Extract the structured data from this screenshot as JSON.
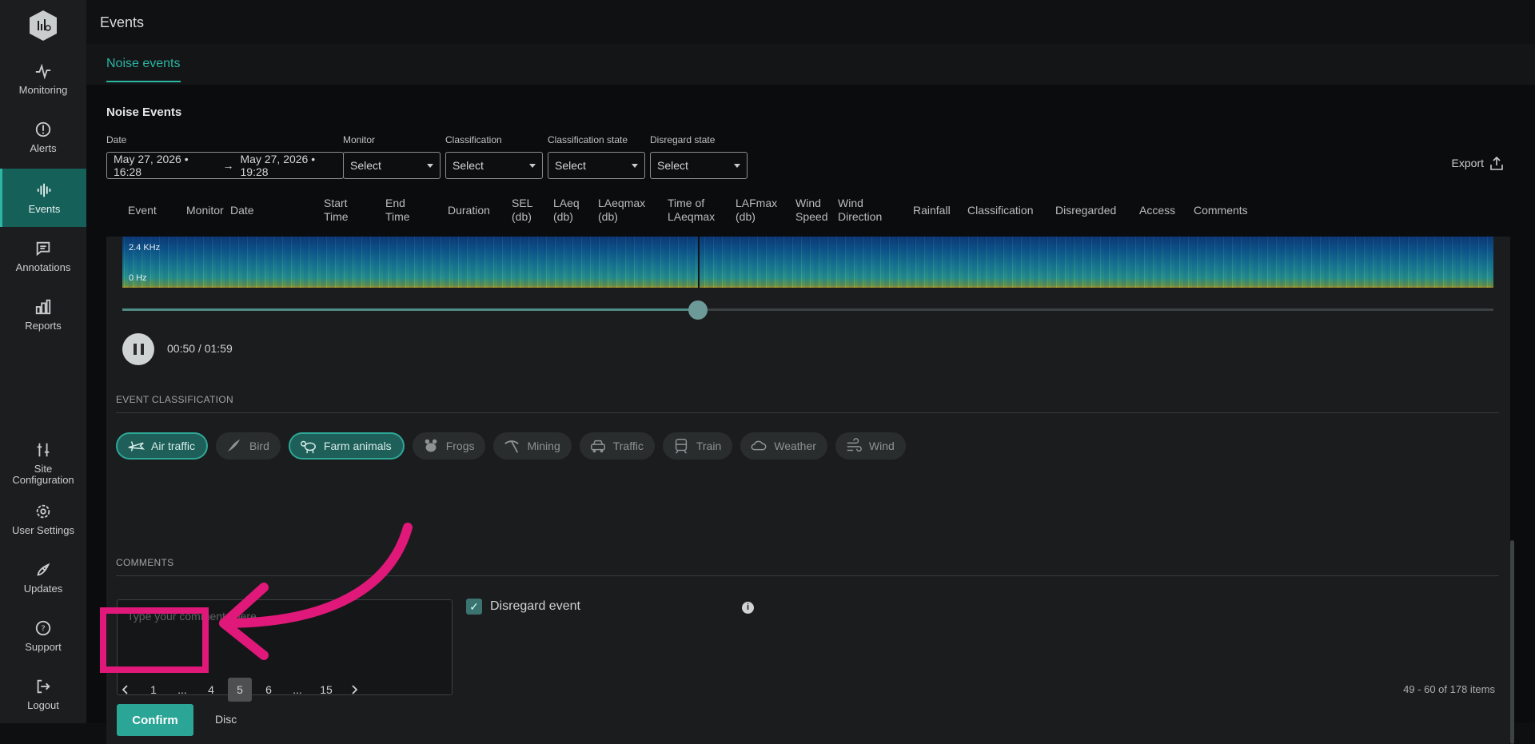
{
  "app": {
    "title": "Events"
  },
  "sidebar": {
    "items": [
      {
        "label": "Monitoring",
        "icon": "pulse-icon",
        "active": false
      },
      {
        "label": "Alerts",
        "icon": "alert-circle-icon",
        "active": false
      },
      {
        "label": "Events",
        "icon": "waveform-icon",
        "active": true
      },
      {
        "label": "Annotations",
        "icon": "chat-icon",
        "active": false
      },
      {
        "label": "Reports",
        "icon": "bar-chart-icon",
        "active": false
      },
      {
        "label": "Site Configuration",
        "icon": "sliders-icon",
        "active": false
      },
      {
        "label": "User Settings",
        "icon": "gear-icon",
        "active": false
      },
      {
        "label": "Updates",
        "icon": "rocket-icon",
        "active": false
      },
      {
        "label": "Support",
        "icon": "help-circle-icon",
        "active": false
      },
      {
        "label": "Logout",
        "icon": "logout-icon",
        "active": false
      }
    ]
  },
  "tabs": [
    {
      "label": "Noise events",
      "active": true
    }
  ],
  "section": {
    "title": "Noise Events"
  },
  "filters": {
    "date": {
      "label": "Date",
      "from": "May 27, 2026 • 16:28",
      "arrow": "→",
      "to": "May 27, 2026 • 19:28"
    },
    "monitor": {
      "label": "Monitor",
      "value": "Select"
    },
    "classification": {
      "label": "Classification",
      "value": "Select"
    },
    "classification_state": {
      "label": "Classification state",
      "value": "Select"
    },
    "disregard_state": {
      "label": "Disregard state",
      "value": "Select"
    }
  },
  "export": {
    "label": "Export"
  },
  "columns": [
    "Event",
    "Monitor",
    "Date",
    "Start\nTime",
    "End\nTime",
    "Duration",
    "SEL\n(db)",
    "LAeq\n(db)",
    "LAeqmax\n(db)",
    "Time of\nLAeqmax",
    "LAFmax\n(db)",
    "Wind\nSpeed",
    "Wind\nDirection",
    "Rainfall",
    "Classification",
    "Disregarded",
    "Access",
    "Comments"
  ],
  "player": {
    "freq_high": "2.4 KHz",
    "freq_low": "0   Hz",
    "current": "00:50",
    "total": "01:59",
    "time_display": "00:50 / 01:59",
    "progress": 0.42
  },
  "classification": {
    "heading": "EVENT CLASSIFICATION",
    "chips": [
      {
        "label": "Air traffic",
        "icon": "plane-icon",
        "selected": true
      },
      {
        "label": "Bird",
        "icon": "bird-icon",
        "selected": false
      },
      {
        "label": "Farm animals",
        "icon": "cow-icon",
        "selected": true
      },
      {
        "label": "Frogs",
        "icon": "frog-icon",
        "selected": false
      },
      {
        "label": "Mining",
        "icon": "pickaxe-icon",
        "selected": false
      },
      {
        "label": "Traffic",
        "icon": "car-icon",
        "selected": false
      },
      {
        "label": "Train",
        "icon": "train-icon",
        "selected": false
      },
      {
        "label": "Weather",
        "icon": "cloud-icon",
        "selected": false
      },
      {
        "label": "Wind",
        "icon": "wind-icon",
        "selected": false
      }
    ]
  },
  "comments": {
    "heading": "COMMENTS",
    "placeholder": "Type your comments here",
    "disregard_label": "Disregard event",
    "disregard_checked": true
  },
  "actions": {
    "confirm": "Confirm",
    "discard": "Disc"
  },
  "pagination": {
    "pages": [
      "1",
      "...",
      "4",
      "5",
      "6",
      "...",
      "15"
    ],
    "current": "5",
    "summary": "49 - 60 of 178 items"
  },
  "colors": {
    "accent": "#2ba596",
    "highlight": "#e0187a",
    "active_nav": "#16605a"
  }
}
